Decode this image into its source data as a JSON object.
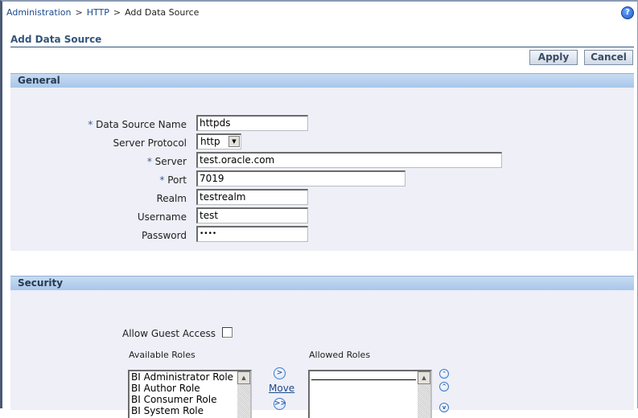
{
  "breadcrumb": {
    "items": [
      "Administration",
      "HTTP"
    ],
    "separator": ">",
    "current": "Add Data Source"
  },
  "help_icon": "?",
  "page_title": "Add Data Source",
  "actions": {
    "apply": "Apply",
    "cancel": "Cancel"
  },
  "general": {
    "title": "General",
    "required_marker": "*",
    "fields": {
      "data_source_name": {
        "label": "Data Source Name",
        "value": "httpds",
        "required": true
      },
      "server_protocol": {
        "label": "Server Protocol",
        "value": "http"
      },
      "server": {
        "label": "Server",
        "value": "test.oracle.com",
        "required": true
      },
      "port": {
        "label": "Port",
        "value": "7019",
        "required": true
      },
      "realm": {
        "label": "Realm",
        "value": "testrealm"
      },
      "username": {
        "label": "Username",
        "value": "test"
      },
      "password": {
        "label": "Password",
        "value": "••••"
      }
    }
  },
  "security": {
    "title": "Security",
    "allow_guest_access": {
      "label": "Allow Guest Access",
      "checked": false
    },
    "available_roles": {
      "label": "Available Roles",
      "items": [
        "BI Administrator Role",
        "BI Author Role",
        "BI Consumer Role",
        "BI System Role"
      ]
    },
    "move_label": "Move",
    "allowed_roles": {
      "label": "Allowed Roles",
      "items": []
    }
  }
}
